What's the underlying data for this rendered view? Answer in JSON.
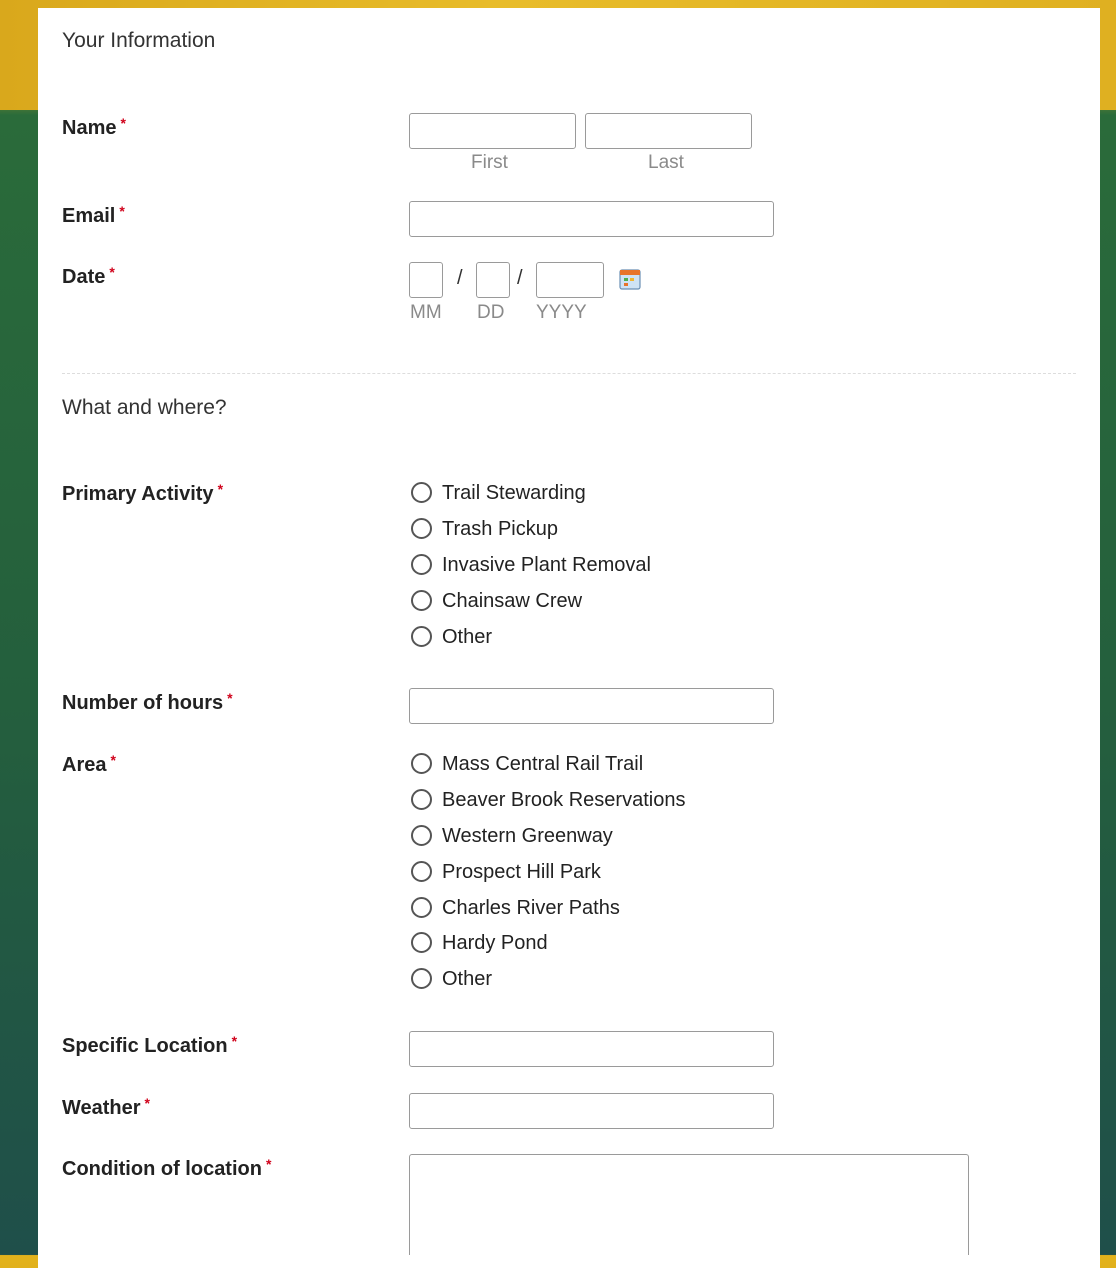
{
  "sections": {
    "info_title": "Your Information",
    "where_title": "What and where?"
  },
  "fields": {
    "name": {
      "label": "Name",
      "first_sublabel": "First",
      "last_sublabel": "Last",
      "required_mark": "*"
    },
    "email": {
      "label": "Email",
      "required_mark": "*"
    },
    "date": {
      "label": "Date",
      "required_mark": "*",
      "mm": "MM",
      "dd": "DD",
      "yyyy": "YYYY",
      "separator": "/"
    },
    "primary_activity": {
      "label": "Primary Activity",
      "required_mark": "*",
      "options": [
        "Trail Stewarding",
        "Trash Pickup",
        "Invasive Plant Removal",
        "Chainsaw Crew",
        "Other"
      ]
    },
    "hours": {
      "label": "Number of hours",
      "required_mark": "*"
    },
    "area": {
      "label": "Area",
      "required_mark": "*",
      "options": [
        "Mass Central Rail Trail",
        "Beaver Brook Reservations",
        "Western Greenway",
        "Prospect Hill Park",
        "Charles River Paths",
        "Hardy Pond",
        "Other"
      ]
    },
    "specific_location": {
      "label": "Specific Location",
      "required_mark": "*"
    },
    "weather": {
      "label": "Weather",
      "required_mark": "*"
    },
    "condition": {
      "label": "Condition of location",
      "required_mark": "*"
    }
  },
  "icons": {
    "calendar": "calendar-icon"
  },
  "colors": {
    "required": "#d0021b",
    "background_gold": "#e3b21c",
    "background_green": "#245f3d"
  }
}
